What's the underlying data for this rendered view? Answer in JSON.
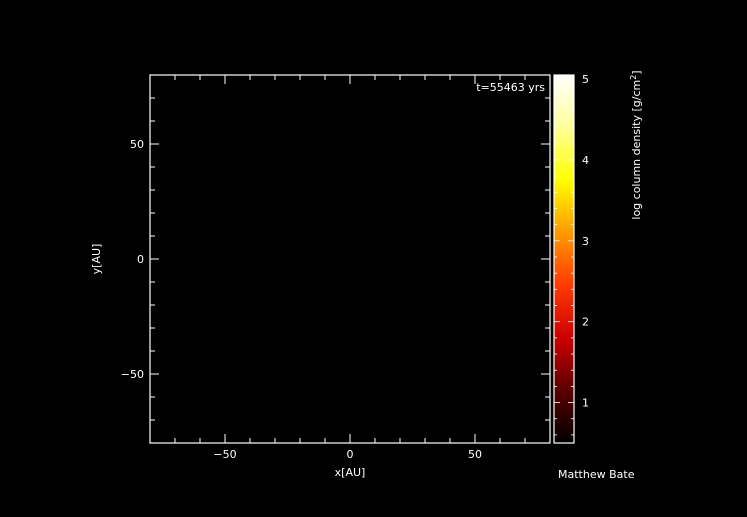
{
  "chart_data": {
    "type": "heatmap",
    "title": "",
    "annotation": "t=55463 yrs",
    "xlabel": "x[AU]",
    "ylabel": "y[AU]",
    "xlim": [
      -80,
      80
    ],
    "ylim": [
      -80,
      80
    ],
    "x_ticks": [
      -50,
      0,
      50
    ],
    "y_ticks": [
      -50,
      0,
      50
    ],
    "x_tick_labels": [
      "−50",
      "0",
      "50"
    ],
    "y_tick_labels": [
      "−50",
      "0",
      "50"
    ],
    "grid": false,
    "image": "empty black field",
    "colorbar": {
      "label": "log column density [g/cm",
      "label_superscript": "2",
      "label_end": "]",
      "range": [
        0.5,
        5.05
      ],
      "ticks": [
        1,
        2,
        3,
        4,
        5
      ],
      "tick_labels": [
        "1",
        "2",
        "3",
        "4",
        "5"
      ],
      "colormap": [
        "#000000",
        "#5a0000",
        "#cc0000",
        "#ff3a00",
        "#ff9a00",
        "#ffff00",
        "#ffff99",
        "#ffffff"
      ]
    },
    "credit": "Matthew Bate"
  },
  "colors": {
    "background": "#000000",
    "foreground": "#ffffff"
  }
}
